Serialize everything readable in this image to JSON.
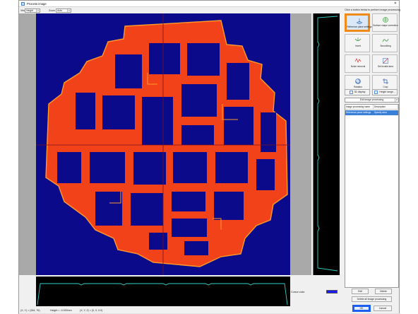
{
  "window": {
    "title": "Process image",
    "close_glyph": "✕"
  },
  "toolbar": {
    "view_label": "View",
    "view_value": "Height",
    "zoom_label": "Zoom",
    "zoom_value": "Auto"
  },
  "colors": {
    "accent_orange": "#f08a18",
    "accent_blue": "#1d5ff0",
    "image_background": "#0a0a8a",
    "part_red": "#f2421a",
    "profile_cyan": "#35d0c8"
  },
  "panel": {
    "hint": "Click a button below to perform image processing.",
    "buttons": [
      {
        "label": "Reference plane settings",
        "icon": "reference-plane-icon"
      },
      {
        "label": "Surface shape correction",
        "icon": "surface-shape-icon"
      },
      {
        "label": "Invert",
        "icon": "invert-icon"
      },
      {
        "label": "Smoothing",
        "icon": "smoothing-icon"
      },
      {
        "label": "Noise removal",
        "icon": "noise-removal-icon"
      },
      {
        "label": "Set invalid area",
        "icon": "invalid-area-icon"
      },
      {
        "label": "Rotation",
        "icon": "rotation-icon"
      },
      {
        "label": "Crop",
        "icon": "crop-icon"
      }
    ],
    "display_3d": "3D display",
    "height_range": "Height range...",
    "edit_combo": "Edit image processing",
    "table": {
      "headers": [
        "Image processing name",
        "Description"
      ],
      "rows": [
        {
          "name": "Reference plane settings",
          "description": "Specify area"
        }
      ]
    },
    "edit": "Edit",
    "delete": "Delete",
    "delete_all": "Delete all image processing",
    "ok": "OK",
    "cancel": "Cancel"
  },
  "cursor_color_label": "Cursor color",
  "status": {
    "position": "(X, Y) = (284, 76)",
    "height": "Height = -0.000mm",
    "coords": "(X, Y, Z) = (0, 0, 0.0)"
  }
}
